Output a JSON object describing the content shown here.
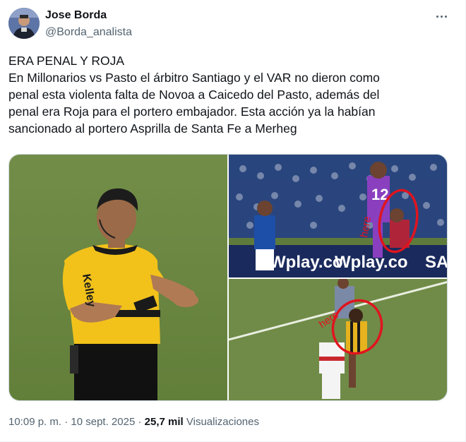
{
  "author": {
    "name": "Jose Borda",
    "handle": "@Borda_analista"
  },
  "tweet": {
    "lines": [
      "ERA PENAL Y ROJA",
      "En Millonarios  vs Pasto el árbitro Santiago y el VAR no dieron como",
      "penal esta violenta falta de Novoa a Caicedo del Pasto, además del",
      "penal era Roja para el portero embajador. Esta acción ya la habían",
      "sancionado al portero Asprilla de Santa Fe a Merheg"
    ]
  },
  "media": {
    "left_label": "Kelley",
    "top_right_board_1": "Wplay.co",
    "top_right_board_2": "Wplay.co",
    "top_right_board_3": "SA",
    "top_right_annotation": "here",
    "bottom_right_annotation": "here",
    "annotation_color": "#e0141e"
  },
  "meta": {
    "time": "10:09 p. m.",
    "separator": "·",
    "date": "10 sept. 2025",
    "views_count": "25,7 mil",
    "views_label": "Visualizaciones"
  }
}
